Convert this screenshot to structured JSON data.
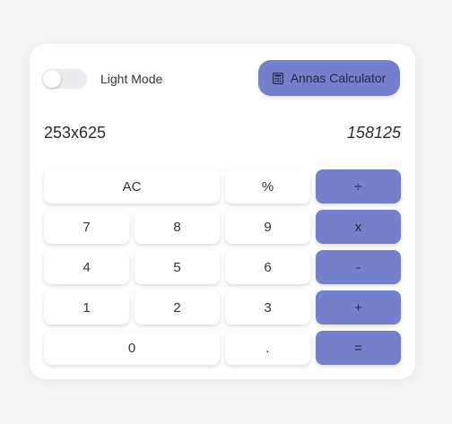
{
  "theme": {
    "accent": "#7480c9",
    "background": "#f5f5f6",
    "card": "#ffffff"
  },
  "header": {
    "toggle_on": false,
    "mode_label": "Light Mode",
    "title_icon": "calculator-icon",
    "title_label": "Annas Calculator"
  },
  "display": {
    "expression": "253x625",
    "result": "158125"
  },
  "keypad": {
    "ac": "AC",
    "percent": "%",
    "divide": "÷",
    "seven": "7",
    "eight": "8",
    "nine": "9",
    "multiply": "x",
    "four": "4",
    "five": "5",
    "six": "6",
    "minus": "-",
    "one": "1",
    "two": "2",
    "three": "3",
    "plus": "+",
    "zero": "0",
    "dot": ".",
    "equals": "="
  }
}
